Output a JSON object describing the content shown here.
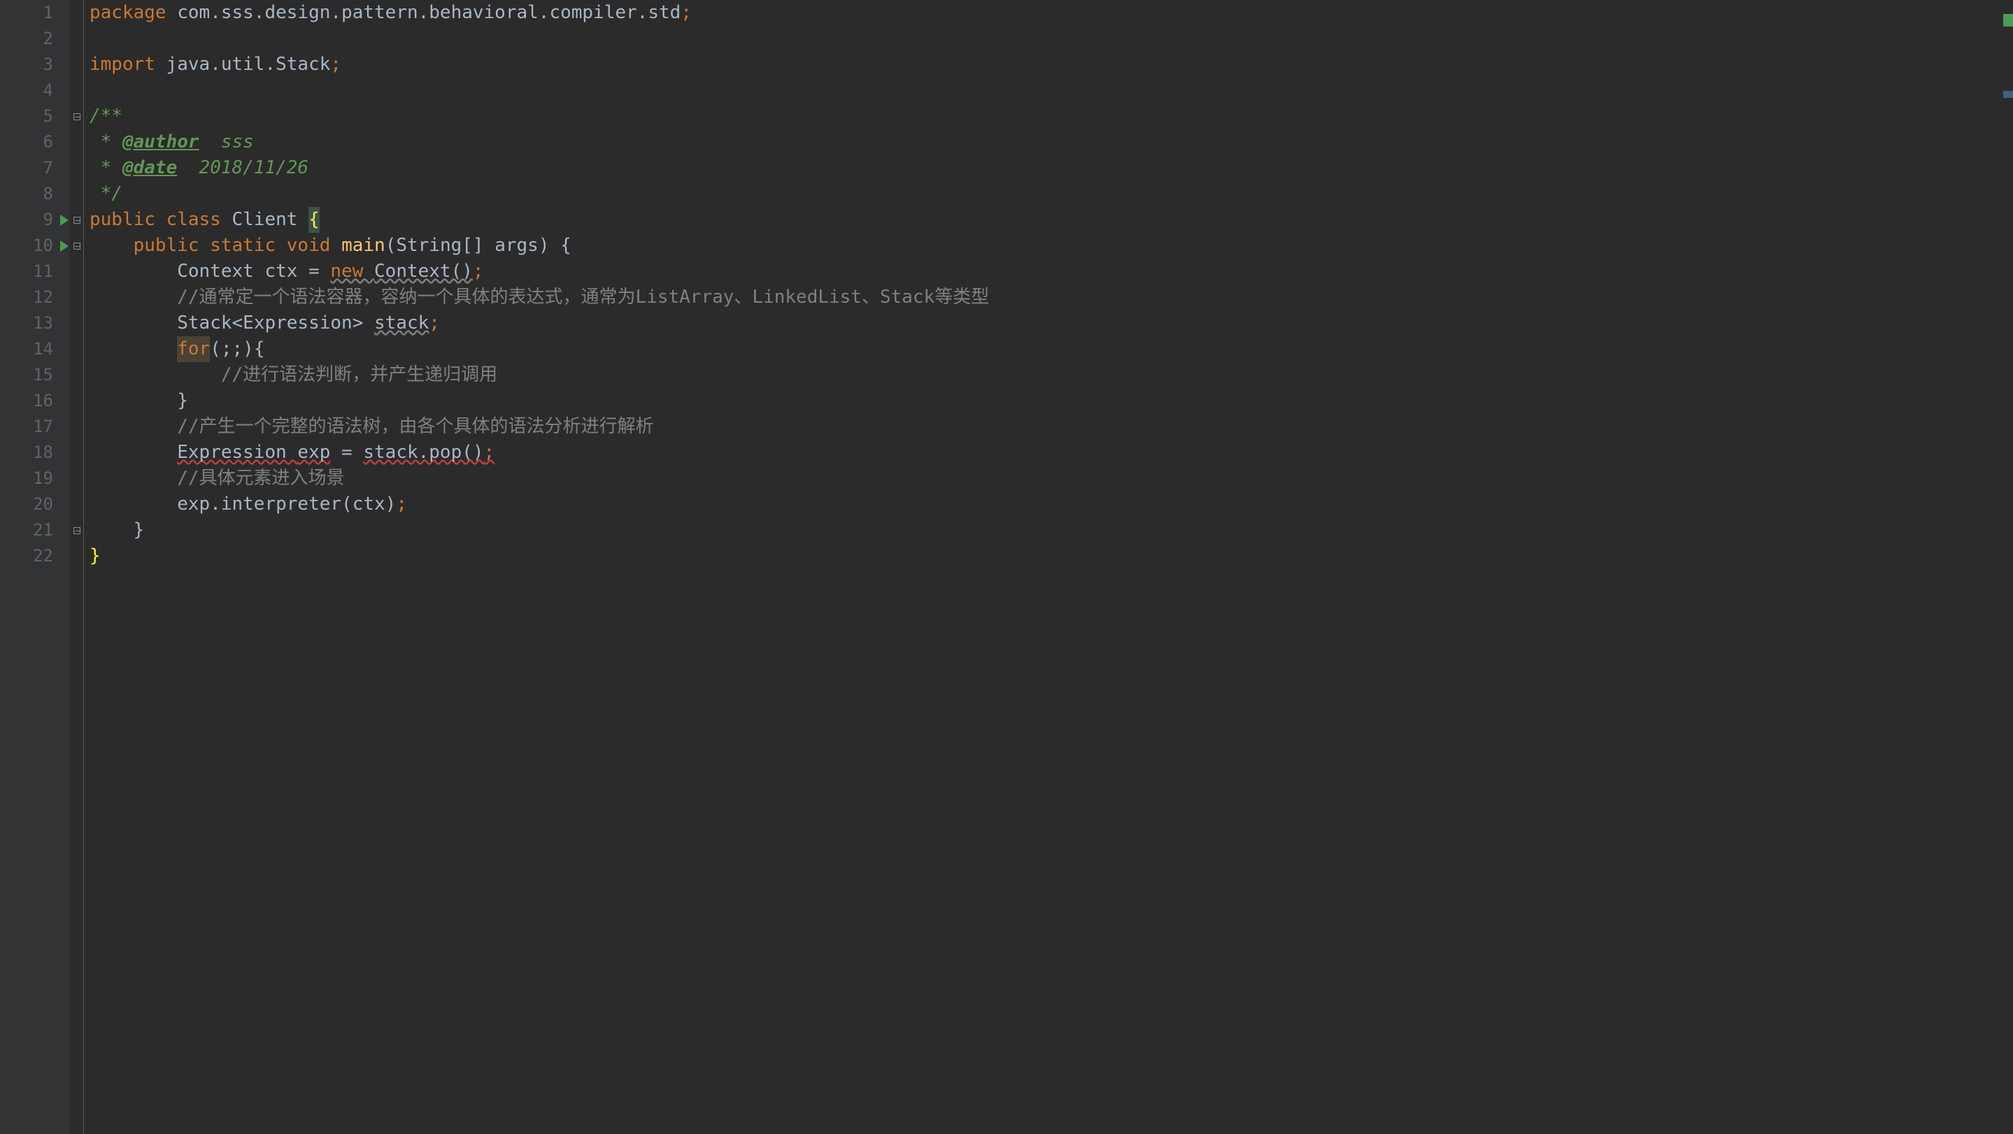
{
  "lines": {
    "l1": {
      "num": "1",
      "package_kw": "package ",
      "pkg": "com.sss.design.pattern.behavioral.compiler.std",
      "semi": ";"
    },
    "l2": {
      "num": "2"
    },
    "l3": {
      "num": "3",
      "import_kw": "import ",
      "pkg": "java.util.Stack",
      "semi": ";"
    },
    "l4": {
      "num": "4"
    },
    "l5": {
      "num": "5",
      "doc": "/**"
    },
    "l6": {
      "num": "6",
      "star": " * ",
      "tag": "@author",
      "val": "  sss"
    },
    "l7": {
      "num": "7",
      "star": " * ",
      "tag": "@date",
      "val": "  2018/11/26"
    },
    "l8": {
      "num": "8",
      "doc": " */"
    },
    "l9": {
      "num": "9",
      "mods": "public class ",
      "cls": "Client ",
      "brace": "{"
    },
    "l10": {
      "num": "10",
      "indent": "    ",
      "mods": "public static ",
      "void": "void ",
      "method": "main",
      "params": "(String[] args) {"
    },
    "l11": {
      "num": "11",
      "indent": "        ",
      "type": "Context ctx = ",
      "new": "new ",
      "ctor": "Context()",
      "semi": ";"
    },
    "l12": {
      "num": "12",
      "indent": "        ",
      "comment": "//通常定一个语法容器，容纳一个具体的表达式，通常为ListArray、LinkedList、Stack等类型"
    },
    "l13": {
      "num": "13",
      "indent": "        ",
      "type": "Stack<Expression> ",
      "var": "stack",
      "semi": ";"
    },
    "l14": {
      "num": "14",
      "indent": "        ",
      "for": "for",
      "rest": "(;;){"
    },
    "l15": {
      "num": "15",
      "indent": "            ",
      "comment": "//进行语法判断，并产生递归调用"
    },
    "l16": {
      "num": "16",
      "indent": "        ",
      "brace": "}"
    },
    "l17": {
      "num": "17",
      "indent": "        ",
      "comment": "//产生一个完整的语法树，由各个具体的语法分析进行解析"
    },
    "l18": {
      "num": "18",
      "indent": "        ",
      "type": "Expression ",
      "var": "exp",
      "eq": " = ",
      "call": "stack.pop()",
      "semi": ";"
    },
    "l19": {
      "num": "19",
      "indent": "        ",
      "comment": "//具体元素进入场景"
    },
    "l20": {
      "num": "20",
      "indent": "        ",
      "obj": "exp.interpreter(ctx)",
      "semi": ";"
    },
    "l21": {
      "num": "21",
      "indent": "    ",
      "brace": "}"
    },
    "l22": {
      "num": "22",
      "indent": "",
      "brace": "}"
    }
  }
}
